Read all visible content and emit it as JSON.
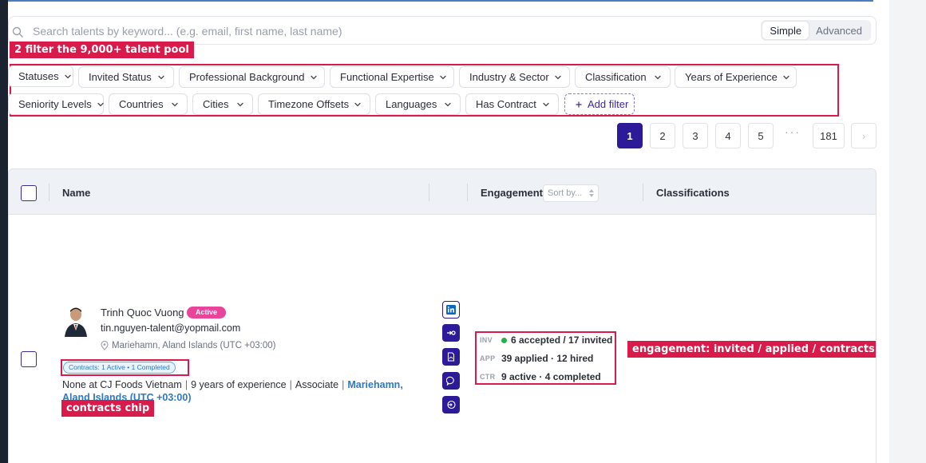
{
  "search": {
    "placeholder": "Search talents by keyword... (e.g. email, first name, last name)",
    "mode_simple": "Simple",
    "mode_advanced": "Advanced"
  },
  "annotations": {
    "filter_pool": "2 filter the 9,000+ talent pool",
    "engagement": "engagement: invited / applied / contracts",
    "contracts_chip": "contracts chip"
  },
  "filters": [
    "Statuses",
    "Invited Status",
    "Professional Background",
    "Functional Expertise",
    "Industry & Sector",
    "Classification",
    "Years of Experience",
    "Seniority Levels",
    "Countries",
    "Cities",
    "Timezone Offsets",
    "Languages",
    "Has Contract"
  ],
  "add_filter_label": "Add filter",
  "pagination": {
    "pages": [
      "1",
      "2",
      "3",
      "4",
      "5"
    ],
    "ellipsis": "···",
    "last": "181",
    "current": "1",
    "next": "›"
  },
  "table": {
    "col_name": "Name",
    "col_engagement": "Engagement",
    "sort_placeholder": "Sort by...",
    "col_classifications": "Classifications"
  },
  "talent": {
    "name": "Trinh Quoc Vuong",
    "status": "Active",
    "email": "tin.nguyen-talent@yopmail.com",
    "location": "Mariehamn, Aland Islands (UTC +03:00)",
    "contracts_chip": "Contracts: 1 Active • 1 Completed",
    "current_role": "None at CJ Foods Vietnam",
    "experience": "9 years of experience",
    "seniority": "Associate",
    "location_link": "Mariehamn, Aland Islands (UTC +03:00)"
  },
  "engagement": {
    "inv_tag": "INV",
    "inv_text": "6 accepted / 17 invited",
    "app_tag": "APP",
    "app_text": "39 applied · 12 hired",
    "ctr_tag": "CTR",
    "ctr_text": "9 active · 4 completed"
  },
  "icons": {
    "search": "search-icon",
    "chevron": "chevron-down-icon",
    "linkedin": "linkedin-icon",
    "invite": "invite-icon",
    "resume": "resume-icon",
    "chat": "chat-icon",
    "login": "login-icon",
    "pin": "map-pin-icon"
  },
  "colors": {
    "primary": "#2d1a99",
    "annotation": "#d81b4a",
    "active_badge": "#e8449a",
    "link": "#2e78c8",
    "status_dot": "#22b14c"
  }
}
